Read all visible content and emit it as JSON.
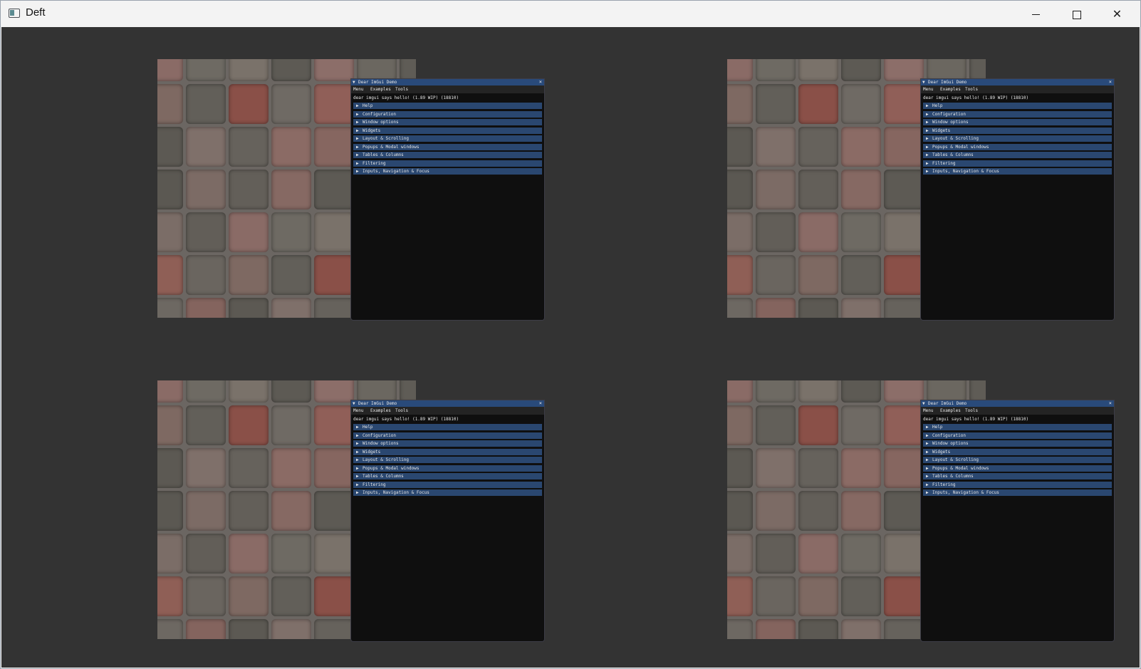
{
  "app": {
    "title": "Deft",
    "icon": "app-window-icon"
  },
  "window_controls": {
    "minimize": "minimize-icon",
    "maximize": "maximize-icon",
    "close": "close-icon",
    "close_glyph": "✕"
  },
  "colors": {
    "client_bg": "#333333",
    "imgui_title_bg": "#294a7a",
    "imgui_header_bg": "#2a4770",
    "imgui_window_bg": "#0f0f0f"
  },
  "imgui_demo": {
    "title": "Dear ImGui Demo",
    "collapse_glyph": "▼",
    "close_glyph": "×",
    "menu": [
      "Menu",
      "Examples",
      "Tools"
    ],
    "hello": "dear imgui says hello! (1.89 WIP) (18810)",
    "arrow_glyph": "▶",
    "headers": [
      "Help",
      "Configuration",
      "Window options",
      "Widgets",
      "Layout & Scrolling",
      "Popups & Modal windows",
      "Tables & Columns",
      "Filtering",
      "Inputs, Navigation & Focus"
    ]
  }
}
